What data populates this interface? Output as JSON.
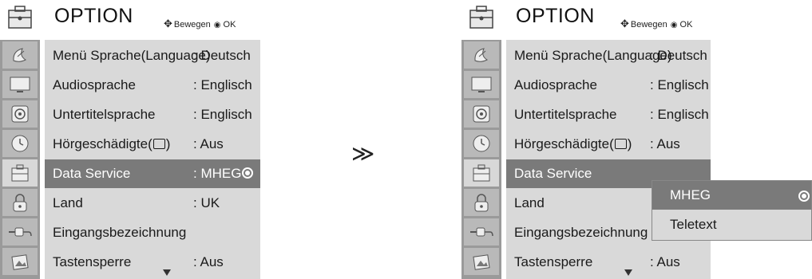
{
  "menu": {
    "title": "OPTION",
    "nav_hint": {
      "move_label": "Bewegen",
      "ok_label": "OK"
    },
    "rows": [
      {
        "label": "Menü Sprache(Language)",
        "value": ": Deutsch"
      },
      {
        "label": "Audiosprache",
        "value": ": Englisch"
      },
      {
        "label": "Untertitelsprache",
        "value": ": Englisch"
      },
      {
        "label_prefix": "Hörgeschädigte(",
        "label_suffix": ")",
        "value": ": Aus"
      },
      {
        "label": "Data Service",
        "value": ": MHEG"
      },
      {
        "label": "Land",
        "value": ": UK"
      },
      {
        "label": "Eingangsbezeichnung",
        "value": ""
      },
      {
        "label": "Tastensperre",
        "value": ": Aus"
      }
    ],
    "selected_row": 4
  },
  "sidebar_icons": [
    "option-header-icon",
    "satellite-dish-icon",
    "tv-screen-icon",
    "speaker-icon",
    "clock-icon",
    "option-icon",
    "lock-icon",
    "input-plug-icon",
    "picture-icon"
  ],
  "step_arrow": "≫",
  "popup": {
    "options": [
      "MHEG",
      "Teletext"
    ],
    "selected_index": 0
  },
  "colors": {
    "selected_row_bg": "#7a7a7a",
    "menu_bg": "#d9d9d9",
    "sidebar_bg": "#9a9a9a"
  }
}
